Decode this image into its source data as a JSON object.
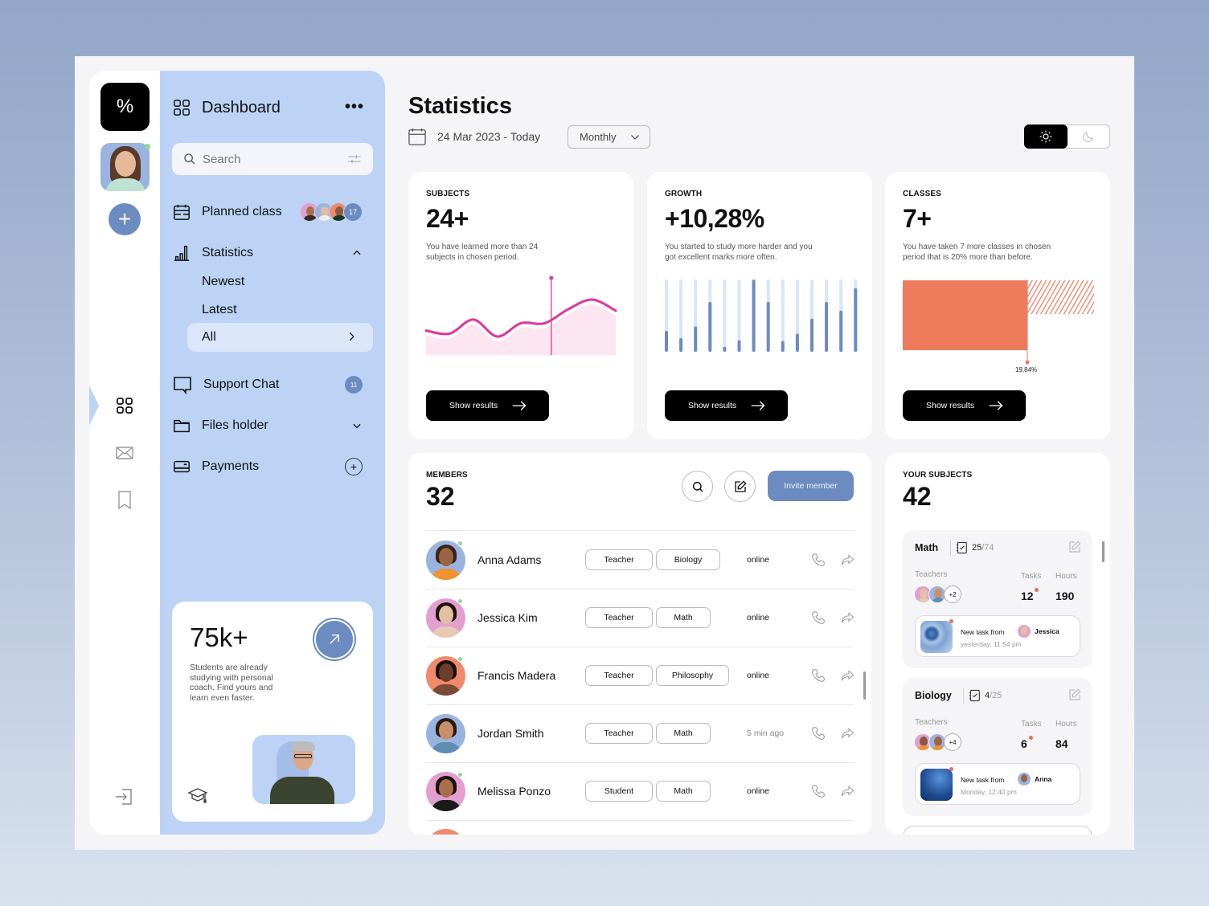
{
  "app": {
    "logo_glyph": "%",
    "accent_color": "#6c8bc0",
    "sidebar_color": "#bcd3f6"
  },
  "rail": {
    "icons": [
      "logo-icon",
      "profile-avatar",
      "add-icon",
      "dashboard-grid-icon",
      "mail-icon",
      "bookmark-icon",
      "logout-icon"
    ],
    "add_glyph": "+"
  },
  "sidebar": {
    "title": "Dashboard",
    "more_glyph": "•••",
    "search": {
      "placeholder": "Search",
      "value": ""
    },
    "items": [
      {
        "label": "Planned class",
        "icon": "calendar-icon",
        "avatars_count": "17"
      },
      {
        "label": "Statistics",
        "icon": "bar-chart-icon",
        "expanded": true,
        "children": [
          "Newest",
          "Latest",
          "All"
        ],
        "selected_child": "All"
      },
      {
        "label": "Support Chat",
        "icon": "chat-icon",
        "badge": "11"
      },
      {
        "label": "Files holder",
        "icon": "folder-icon"
      },
      {
        "label": "Payments",
        "icon": "card-icon",
        "action_glyph": "+"
      }
    ],
    "promo": {
      "value": "75k+",
      "text": "Students are already studying with personal coach. Find yours and learn even faster."
    }
  },
  "main": {
    "title": "Statistics",
    "date_range": "24 Mar 2023 - Today",
    "period_select": {
      "value": "Monthly"
    },
    "theme_toggle": {
      "selected": "light",
      "options": [
        "light",
        "dark"
      ]
    },
    "cards": [
      {
        "label": "SUBJECTS",
        "value": "24+",
        "description": "You have learned more than 24 subjects in chosen period.",
        "button": "Show results"
      },
      {
        "label": "GROWTH",
        "value": "+10,28%",
        "description": "You started to study more harder and you got excellent marks more often.",
        "button": "Show results"
      },
      {
        "label": "CLASSES",
        "value": "7+",
        "description": "You have taken 7 more classes in chosen period that is 20% more than before.",
        "button": "Show results",
        "marker_label": "19,84%"
      }
    ],
    "members": {
      "label": "MEMBERS",
      "count": "32",
      "invite_label": "Invite member",
      "rows": [
        {
          "name": "Anna Adams",
          "role": "Teacher",
          "subject": "Biology",
          "status": "online",
          "online": true,
          "bg": "#9ab4e0",
          "skin": "#9b6444",
          "hair": "#3a2316",
          "shirt": "#f0922e"
        },
        {
          "name": "Jessica Kim",
          "role": "Teacher",
          "subject": "Math",
          "status": "online",
          "online": true,
          "bg": "#e39fcf",
          "skin": "#e3c0a4",
          "hair": "#1d1410",
          "shirt": "#e8cab4"
        },
        {
          "name": "Francis Madera",
          "role": "Teacher",
          "subject": "Philosophy",
          "status": "online",
          "online": true,
          "bg": "#ef8a6c",
          "skin": "#6a3e2a",
          "hair": "#1a100c",
          "shirt": "#7a4a36"
        },
        {
          "name": "Jordan Smith",
          "role": "Teacher",
          "subject": "Math",
          "status": "5 min ago",
          "online": false,
          "bg": "#9ab4e0",
          "skin": "#c8906a",
          "hair": "#2a1a12",
          "shirt": "#5f8db0"
        },
        {
          "name": "Melissa Ponzo",
          "role": "Student",
          "subject": "Math",
          "status": "online",
          "online": true,
          "bg": "#e39fcf",
          "skin": "#a86e4e",
          "hair": "#1a110c",
          "shirt": "#1a1a1a"
        }
      ]
    },
    "your_subjects": {
      "label": "YOUR SUBJECTS",
      "count": "42",
      "teachers_label": "Teachers",
      "tasks_label": "Tasks",
      "hours_label": "Hours",
      "new_task_label": "New task from",
      "items": [
        {
          "name": "Math",
          "done": "25",
          "total": "/74",
          "more_teachers": "+2",
          "tasks": "12",
          "hours": "190",
          "task_from": "Jessica",
          "task_time": "yesterday, 11:54 pm"
        },
        {
          "name": "Biology",
          "done": "4",
          "total": "/25",
          "more_teachers": "+4",
          "tasks": "6",
          "hours": "84",
          "task_from": "Anna",
          "task_time": "Monday, 12:40 pm"
        }
      ]
    }
  },
  "chart_data": [
    {
      "type": "area",
      "title": "SUBJECTS",
      "x": [
        0,
        1,
        2,
        3,
        4,
        5,
        6,
        7,
        8
      ],
      "values": [
        33,
        29,
        48,
        25,
        43,
        43,
        62,
        75,
        60
      ],
      "ylim": [
        0,
        100
      ],
      "marker_index_fraction": 0.66,
      "line_color": "#e0359b",
      "fill_color": "#fce6f2",
      "grid": false
    },
    {
      "type": "bar",
      "title": "GROWTH",
      "categories": [
        "1",
        "2",
        "3",
        "4",
        "5",
        "6",
        "7",
        "8",
        "9",
        "10",
        "11",
        "12",
        "13",
        "14"
      ],
      "values": [
        0.29,
        0.19,
        0.35,
        0.69,
        0.07,
        0.16,
        1.0,
        0.69,
        0.15,
        0.25,
        0.46,
        0.69,
        0.57,
        0.88
      ],
      "ylim": [
        0,
        1
      ],
      "bar_color": "#6c8bc0",
      "track_color": "#d8e5fb"
    },
    {
      "type": "bar",
      "title": "CLASSES",
      "orientation": "horizontal-stacked",
      "segments": [
        {
          "name": "current",
          "value": 0.6534,
          "style": "solid",
          "color": "#ef7b5d"
        },
        {
          "name": "increase",
          "value": 0.3466,
          "style": "hatched",
          "color": "#ef7b5d"
        }
      ],
      "annotation": "19,84%"
    }
  ]
}
